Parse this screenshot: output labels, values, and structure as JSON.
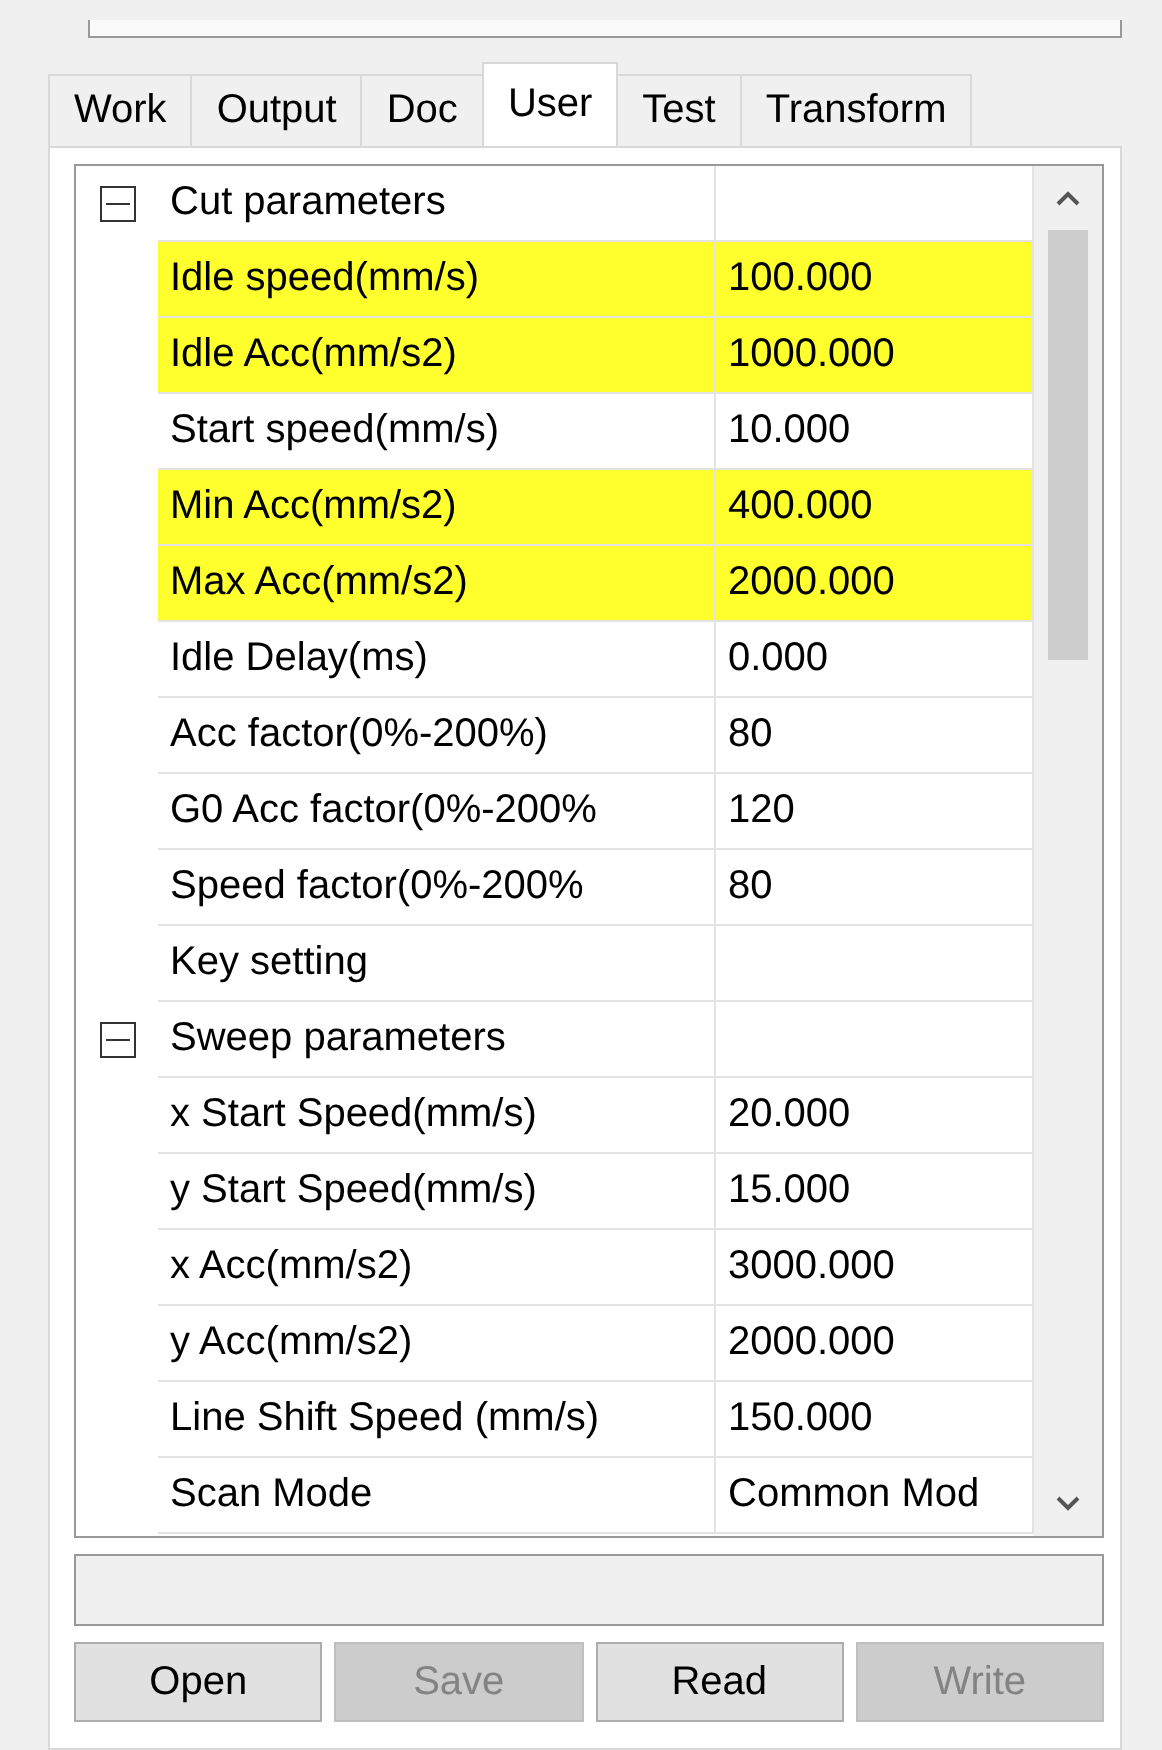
{
  "tabs": [
    {
      "label": "Work",
      "selected": false
    },
    {
      "label": "Output",
      "selected": false
    },
    {
      "label": "Doc",
      "selected": false
    },
    {
      "label": "User",
      "selected": true
    },
    {
      "label": "Test",
      "selected": false
    },
    {
      "label": "Transform",
      "selected": false
    }
  ],
  "sections": [
    {
      "label": "Cut parameters",
      "expanded": true,
      "children": [
        {
          "name": "Idle speed(mm/s)",
          "value": "100.000",
          "highlighted": true
        },
        {
          "name": "Idle Acc(mm/s2)",
          "value": "1000.000",
          "highlighted": true
        },
        {
          "name": "Start speed(mm/s)",
          "value": "10.000",
          "highlighted": false
        },
        {
          "name": "Min Acc(mm/s2)",
          "value": "400.000",
          "highlighted": true
        },
        {
          "name": "Max Acc(mm/s2)",
          "value": "2000.000",
          "highlighted": true
        },
        {
          "name": "Idle Delay(ms)",
          "value": "0.000",
          "highlighted": false
        },
        {
          "name": "Acc factor(0%-200%)",
          "value": "80",
          "highlighted": false
        },
        {
          "name": "G0 Acc factor(0%-200%",
          "value": "120",
          "highlighted": false
        },
        {
          "name": "Speed factor(0%-200%",
          "value": "80",
          "highlighted": false
        },
        {
          "name": "Key setting",
          "highlighted": false
        }
      ]
    },
    {
      "label": "Sweep parameters",
      "expanded": true,
      "children": [
        {
          "name": "x Start Speed(mm/s)",
          "value": "20.000",
          "highlighted": false
        },
        {
          "name": "y Start Speed(mm/s)",
          "value": "15.000",
          "highlighted": false
        },
        {
          "name": "x Acc(mm/s2)",
          "value": "3000.000",
          "highlighted": false
        },
        {
          "name": "y Acc(mm/s2)",
          "value": "2000.000",
          "highlighted": false
        },
        {
          "name": "Line Shift Speed (mm/s)",
          "value": "150.000",
          "highlighted": false
        },
        {
          "name": "Scan Mode",
          "value": "Common Mod",
          "highlighted": false
        }
      ]
    }
  ],
  "buttons": [
    {
      "label": "Open",
      "disabled": false
    },
    {
      "label": "Save",
      "disabled": true
    },
    {
      "label": "Read",
      "disabled": false
    },
    {
      "label": "Write",
      "disabled": true
    }
  ]
}
